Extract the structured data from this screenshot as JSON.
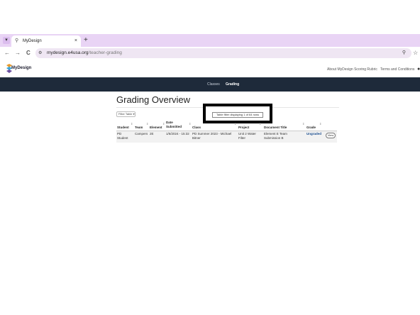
{
  "browser": {
    "tab_menu_icon": "chevron-down-icon",
    "tab_title": "MyDesign",
    "tab_close": "×",
    "new_tab": "+",
    "back": "←",
    "forward": "→",
    "reload": "C",
    "site_info_icon": "tune-icon",
    "url_host": "mydesign.e4usa.org",
    "url_path": "/teacher-grading",
    "zoom_icon": "search-icon",
    "bookmark_icon": "star-icon"
  },
  "site": {
    "logo_text": "MyDesign",
    "links": [
      "About MyDesign Scoring Rubric",
      "Terms and Conditions"
    ],
    "nav": [
      "Classes",
      "Grading"
    ],
    "active_nav": "Grading",
    "colors": {
      "navbar": "#1e2a3a",
      "accent": "#1a4d8f",
      "tab_strip": "#e9d4f5"
    }
  },
  "main": {
    "title": "Grading Overview",
    "filter_button": "Filter Table ▾",
    "filter_status": "Table filter displaying 1 of 64 rows"
  },
  "table": {
    "headers": [
      "Student",
      "Team",
      "Element",
      "Date Submitted",
      "Class",
      "Project",
      "Document Title",
      "Grade"
    ],
    "rows": [
      {
        "student": "PD Student",
        "team": "Campers",
        "element": "2E",
        "date": "1/6/2024 - 15:32",
        "class": "PD Summer 2023 - Michael Bitner",
        "project": "Unit 2 Water Filter",
        "doc_title": "Element E Team Submission B",
        "grade": "Ungraded",
        "action": "View"
      }
    ]
  }
}
